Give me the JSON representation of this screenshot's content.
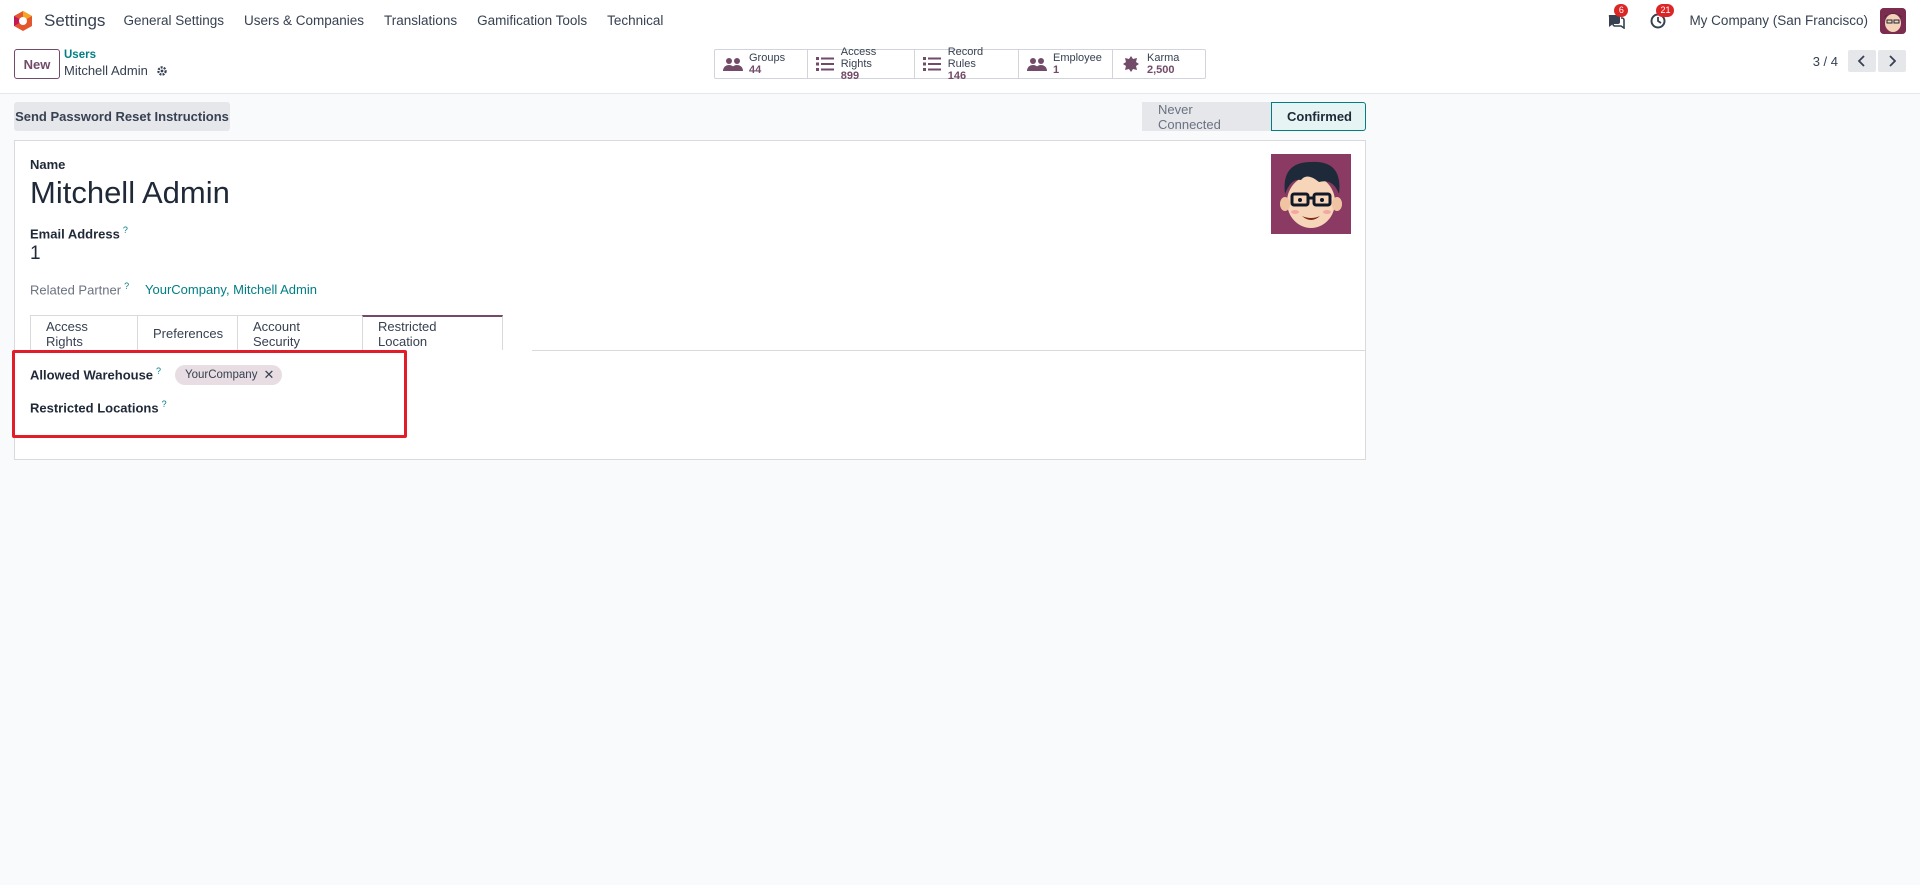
{
  "navbar": {
    "app_name": "Settings",
    "menu": [
      "General Settings",
      "Users & Companies",
      "Translations",
      "Gamification Tools",
      "Technical"
    ],
    "messages_count": "6",
    "activities_count": "21",
    "company": "My Company (San Francisco)"
  },
  "control_panel": {
    "new_label": "New",
    "breadcrumb_parent": "Users",
    "breadcrumb_current": "Mitchell Admin",
    "stats": [
      {
        "label": "Groups",
        "value": "44",
        "icon": "users-icon"
      },
      {
        "label": "Access Rights",
        "value": "899",
        "icon": "list-icon"
      },
      {
        "label": "Record Rules",
        "value": "146",
        "icon": "list-icon"
      },
      {
        "label": "Employee",
        "value": "1",
        "icon": "users-icon"
      },
      {
        "label": "Karma",
        "value": "2,500",
        "icon": "badge-icon"
      }
    ],
    "pager": "3 / 4"
  },
  "form": {
    "reset_button": "Send Password Reset Instructions",
    "status_steps": [
      "Never Connected",
      "Confirmed"
    ],
    "active_status": "Confirmed",
    "name_label": "Name",
    "name_value": "Mitchell Admin",
    "email_label": "Email Address",
    "email_help": "?",
    "email_value": "1",
    "partner_label": "Related Partner",
    "partner_help": "?",
    "partner_value": "YourCompany, Mitchell Admin",
    "tabs": [
      "Access Rights",
      "Preferences",
      "Account Security",
      "Restricted Location"
    ],
    "active_tab": "Restricted Location",
    "allowed_warehouse_label": "Allowed Warehouse",
    "allowed_warehouse_help": "?",
    "allowed_warehouse_tags": [
      "YourCompany"
    ],
    "restricted_locations_label": "Restricted Locations",
    "restricted_locations_help": "?"
  },
  "colors": {
    "brand": "#714b67",
    "link": "#017e84",
    "highlight": "#e11d2a"
  }
}
